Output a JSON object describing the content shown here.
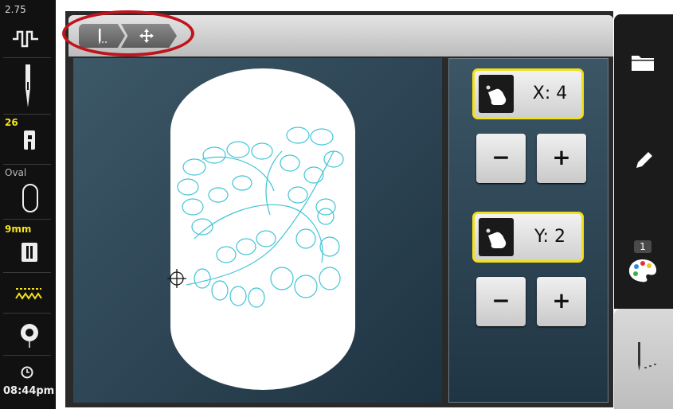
{
  "left_bar": {
    "stitch_length": "2.75",
    "presser_foot_number": "26",
    "hoop_name": "Oval",
    "needle_size": "9mm",
    "clock": "08:44pm"
  },
  "top_tabs": [
    {
      "icon": "quilt-stitch-icon"
    },
    {
      "icon": "move-icon"
    }
  ],
  "position": {
    "x_label": "X: 4",
    "y_label": "Y: 2",
    "minus_label": "−",
    "plus_label": "+"
  },
  "right_bar": {
    "color_count": "1"
  },
  "colors": {
    "highlight_border": "#f0e01e",
    "annotation_ring": "#c0141c",
    "stitch_pattern": "#3ec4d6",
    "yellow_label": "#f5e31b"
  }
}
